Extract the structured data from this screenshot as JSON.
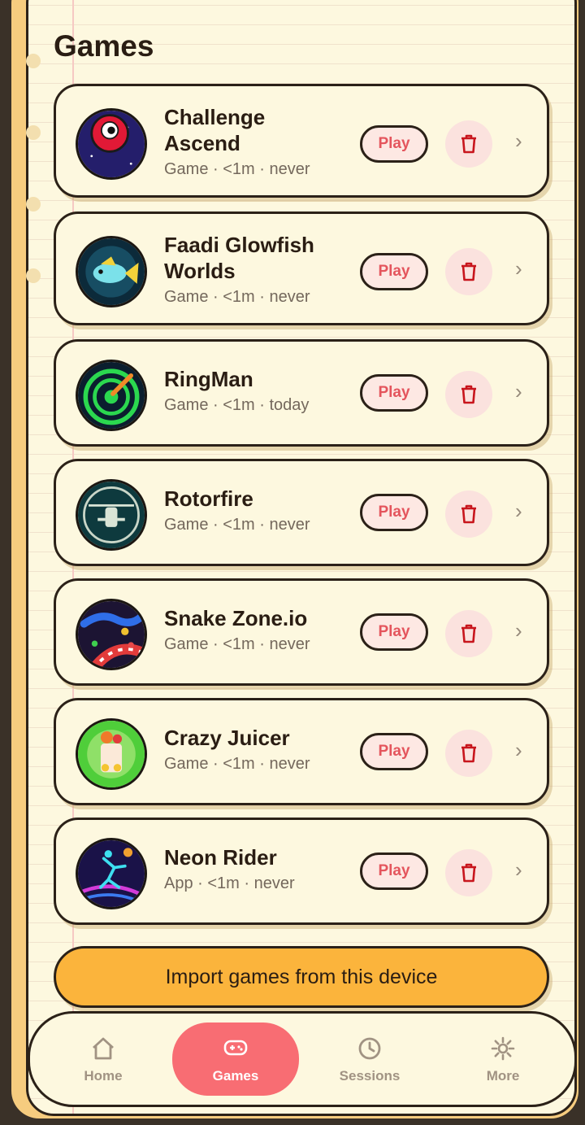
{
  "page": {
    "title": "Games"
  },
  "games": [
    {
      "name_line1": "Challenge",
      "name_line2": "Ascend",
      "meta": "Game · <1m · never",
      "play_label": "Play",
      "icon": "red-ball-icon"
    },
    {
      "name_line1": "Faadi Glowfish",
      "name_line2": "Worlds",
      "meta": "Game · <1m · never",
      "play_label": "Play",
      "icon": "glowfish-icon"
    },
    {
      "name_line1": "RingMan",
      "name_line2": "",
      "meta": "Game · <1m · today",
      "play_label": "Play",
      "icon": "green-ring-icon"
    },
    {
      "name_line1": "Rotorfire",
      "name_line2": "",
      "meta": "Game · <1m · never",
      "play_label": "Play",
      "icon": "helicopter-icon"
    },
    {
      "name_line1": "Snake Zone.io",
      "name_line2": "",
      "meta": "Game · <1m · never",
      "play_label": "Play",
      "icon": "snake-icon"
    },
    {
      "name_line1": "Crazy Juicer",
      "name_line2": "",
      "meta": "Game · <1m · never",
      "play_label": "Play",
      "icon": "juice-icon"
    },
    {
      "name_line1": "Neon Rider",
      "name_line2": "",
      "meta": "App · <1m · never",
      "play_label": "Play",
      "icon": "neon-rider-icon"
    }
  ],
  "import_button": {
    "label": "Import games from this device"
  },
  "nav": {
    "home": "Home",
    "games": "Games",
    "sessions": "Sessions",
    "more": "More"
  },
  "colors": {
    "accent": "#f86d73",
    "import": "#fbb43c",
    "play_text": "#e4555d",
    "page_bg": "#fdf8df",
    "binder": "#f6cc7f"
  }
}
